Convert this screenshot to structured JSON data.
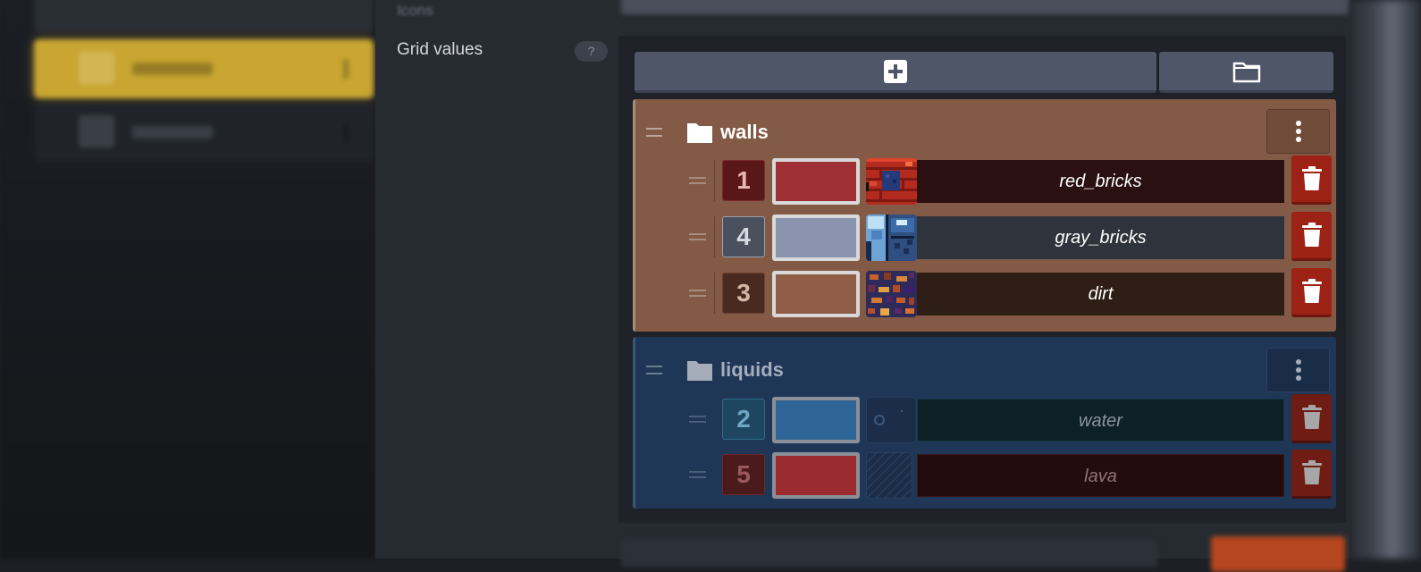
{
  "background": {
    "faded_label": "Icons"
  },
  "field": {
    "label": "Grid values",
    "help": "?"
  },
  "toolbar": {
    "add_icon": "plus-square-icon",
    "folder_icon": "folder-outline-icon"
  },
  "groups": [
    {
      "name": "walls",
      "color": "#835a45",
      "values": [
        {
          "id": "1",
          "color": "#9e2f34",
          "name": "red_bricks",
          "tile": "red-bricks-tile"
        },
        {
          "id": "4",
          "color": "#8a94ae",
          "name": "gray_bricks",
          "tile": "gray-bricks-tile"
        },
        {
          "id": "3",
          "color": "#8f5c46",
          "name": "dirt",
          "tile": "dirt-tile"
        }
      ]
    },
    {
      "name": "liquids",
      "color": "#1f3657",
      "values": [
        {
          "id": "2",
          "color": "#2f6596",
          "name": "water",
          "tile": "water-tile"
        },
        {
          "id": "5",
          "color": "#9a2c30",
          "name": "lava",
          "tile": "lava-tile"
        }
      ]
    }
  ]
}
